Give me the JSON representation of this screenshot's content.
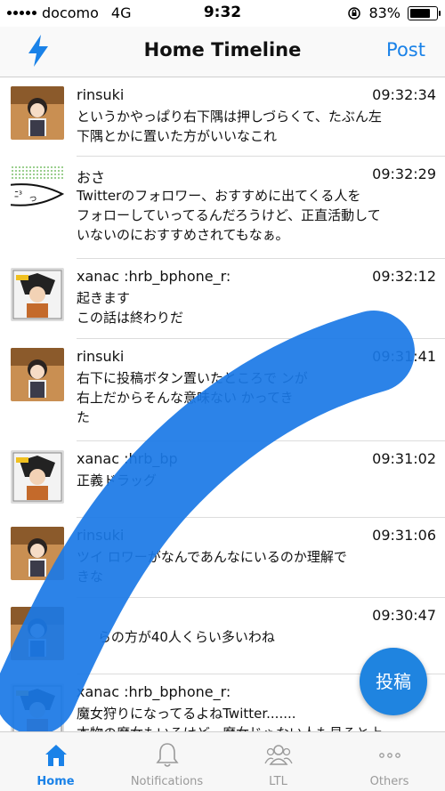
{
  "status_bar": {
    "carrier": "docomo",
    "network": "4G",
    "time": "9:32",
    "battery": "83%"
  },
  "nav": {
    "title": "Home Timeline",
    "post_label": "Post",
    "left_icon": "bolt-icon"
  },
  "tweets": [
    {
      "user": "rinsuki",
      "time": "09:32:34",
      "lines": [
        "というかやっぱり右下隅は押しづらくて、たぶん左",
        "下隅とかに置いた方がいいなこれ"
      ]
    },
    {
      "user": "おさ",
      "time": "09:32:29",
      "lines": [
        "Twitterのフォロワー、おすすめに出てくる人を",
        "フォローしていってるんだろうけど、正直活動して",
        "いないのにおすすめされてもなぁ。"
      ]
    },
    {
      "user": "xanac :hrb_bphone_r:",
      "time": "09:32:12",
      "lines": [
        "起きます",
        "この話は終わりだ"
      ]
    },
    {
      "user": "rinsuki",
      "time": "09:31:41",
      "lines": [
        "右下に投稿ボタン置いたところで                     ンが",
        "右上だからそんな意味ない                       かってき",
        "た"
      ]
    },
    {
      "user": "xanac :hrb_bp",
      "time": "09:31:02",
      "lines": [
        "正義ドラッグ"
      ]
    },
    {
      "user": "rinsuki",
      "time": "09:31:06",
      "lines": [
        "ツイ        ロワーがなんであんなにいるのか理解で",
        "きな"
      ]
    },
    {
      "user": "",
      "time": "09:30:47",
      "lines": [
        "     らの方が40人くらい多いわね"
      ]
    },
    {
      "user": "xanac :hrb_bphone_r:",
      "time": "",
      "lines": [
        "魔女狩りになってるよねTwitter.......",
        "本物の魔女もいるけど、魔女じゃない人も見ると上"
      ]
    }
  ],
  "fab_label": "投稿",
  "tabs": [
    {
      "label": "Home",
      "icon": "home-icon",
      "active": true
    },
    {
      "label": "Notifications",
      "icon": "bell-icon",
      "active": false
    },
    {
      "label": "LTL",
      "icon": "people-icon",
      "active": false
    },
    {
      "label": "Others",
      "icon": "more-icon",
      "active": false
    }
  ],
  "colors": {
    "accent": "#1a82e8",
    "swipe": "#1a78e6"
  }
}
